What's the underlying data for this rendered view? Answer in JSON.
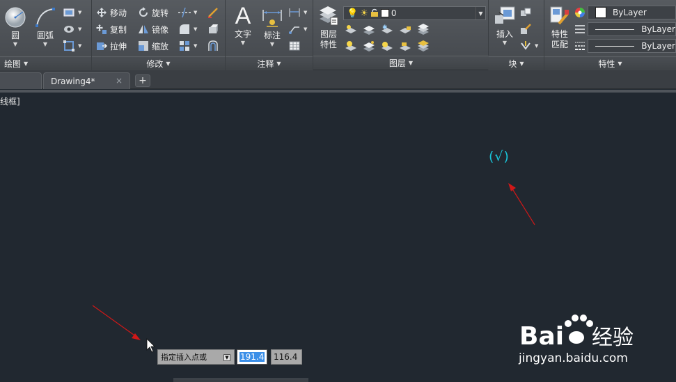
{
  "ribbon": {
    "draw": {
      "circle_label": "圆",
      "arc_label": "圆弧",
      "footer": "绘图"
    },
    "modify": {
      "move_label": "移动",
      "rotate_label": "旋转",
      "copy_label": "复制",
      "mirror_label": "镜像",
      "stretch_label": "拉伸",
      "scale_label": "缩放",
      "footer": "修改"
    },
    "annotation": {
      "text_label": "文字",
      "dimension_label": "标注",
      "footer": "注释"
    },
    "layers": {
      "properties_label_line1": "图层",
      "properties_label_line2": "特性",
      "current_layer": "0",
      "footer": "图层"
    },
    "block": {
      "insert_label": "插入",
      "footer": "块"
    },
    "properties": {
      "match_label_line1": "特性",
      "match_label_line2": "匹配",
      "color_value": "ByLayer",
      "linetype_value": "ByLayer",
      "lineweight_value": "ByLayer",
      "footer": "特性"
    }
  },
  "tabs": {
    "active_tab": "Drawing4*",
    "close_glyph": "×",
    "add_glyph": "+"
  },
  "canvas": {
    "viewport_label": "线框]",
    "drawn_text": "(√)"
  },
  "dynamic_input": {
    "prompt": "指定插入点或",
    "x_value": "191.4",
    "y_value": "116.4"
  },
  "watermark": {
    "url": "jingyan.baidu.com"
  },
  "colors": {
    "canvas_bg": "#212830",
    "cad_text": "#19c4d8",
    "annotation_arrow": "#d01818",
    "selection_highlight": "#3b8fe8"
  }
}
